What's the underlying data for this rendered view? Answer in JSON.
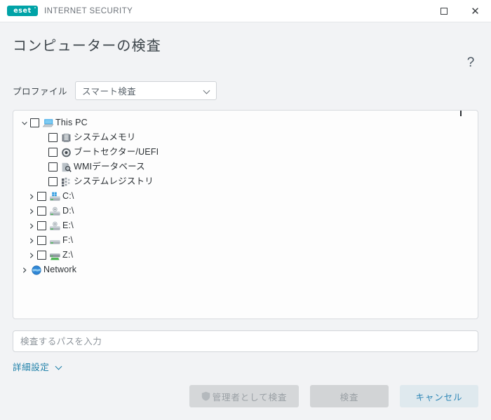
{
  "window": {
    "brand_mark": "eset",
    "brand_name": "INTERNET SECURITY",
    "maximize_label": "",
    "close_label": "✕",
    "accent_color": "#00a3a7",
    "link_color": "#1c7fa8",
    "cancel_bg_color": "#dfe9ee",
    "background_color": "#f2f3f5"
  },
  "header": {
    "title": "コンピューターの検査",
    "help_label": "?"
  },
  "profile": {
    "label": "プロファイル",
    "selected": "スマート検査",
    "chevron_icon": "chevron-down-icon"
  },
  "tree": {
    "nodes": [
      {
        "label": "This PC",
        "icon": "computer-icon",
        "indent": "indent-1",
        "expander": "chevron-down",
        "checkbox": true
      },
      {
        "label": "システムメモリ",
        "icon": "memory-icon",
        "indent": "indent-2",
        "expander": "none",
        "checkbox": true
      },
      {
        "label": "ブートセクター/UEFI",
        "icon": "disc-icon",
        "indent": "indent-2",
        "expander": "none",
        "checkbox": true
      },
      {
        "label": "WMIデータベース",
        "icon": "wmi-icon",
        "indent": "indent-2",
        "expander": "none",
        "checkbox": true
      },
      {
        "label": "システムレジストリ",
        "icon": "registry-icon",
        "indent": "indent-2",
        "expander": "none",
        "checkbox": true
      },
      {
        "label": "C:\\",
        "icon": "windows-drive-icon",
        "indent": "indent-2b",
        "expander": "chevron-right",
        "checkbox": true
      },
      {
        "label": "D:\\",
        "icon": "optical-drive-icon",
        "indent": "indent-2b",
        "expander": "chevron-right",
        "checkbox": true
      },
      {
        "label": "E:\\",
        "icon": "optical-drive-icon",
        "indent": "indent-2b",
        "expander": "chevron-right",
        "checkbox": true
      },
      {
        "label": "F:\\",
        "icon": "hard-drive-icon",
        "indent": "indent-2b",
        "expander": "chevron-right",
        "checkbox": true
      },
      {
        "label": "Z:\\",
        "icon": "network-drive-icon",
        "indent": "indent-2b",
        "expander": "chevron-right",
        "checkbox": true
      },
      {
        "label": "Network",
        "icon": "globe-icon",
        "indent": "indent-1",
        "expander": "chevron-right",
        "checkbox": false
      }
    ]
  },
  "path_field": {
    "value": "",
    "placeholder": "検査するパスを入力"
  },
  "advanced": {
    "label": "詳細設定",
    "chevron_icon": "chevron-down-icon"
  },
  "footer": {
    "admin_scan_label": "管理者として検査",
    "admin_scan_icon": "shield-icon",
    "scan_label": "検査",
    "cancel_label": "キャンセル"
  }
}
